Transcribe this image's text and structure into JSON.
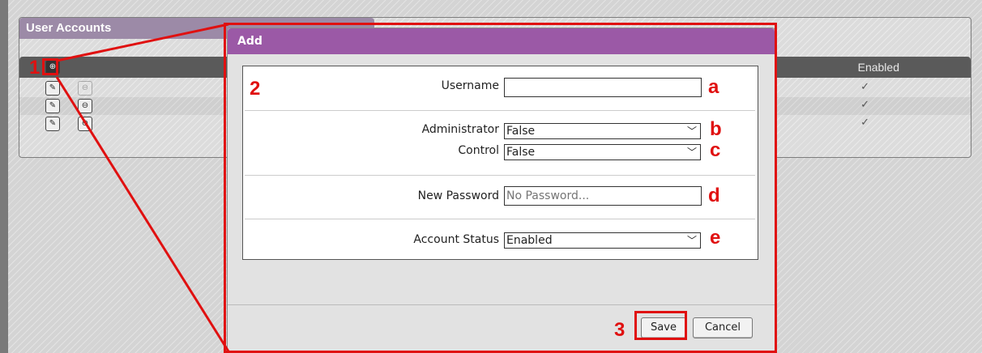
{
  "background_panel": {
    "title": "User Accounts",
    "enabled_column": "Enabled",
    "rows": [
      {
        "enabled": "✓"
      },
      {
        "enabled": "✓"
      },
      {
        "enabled": "✓"
      }
    ]
  },
  "dialog": {
    "title": "Add",
    "fields": {
      "username_label": "Username",
      "username_value": "",
      "administrator_label": "Administrator",
      "administrator_value": "False",
      "control_label": "Control",
      "control_value": "False",
      "new_password_label": "New Password",
      "new_password_placeholder": "No Password...",
      "account_status_label": "Account Status",
      "account_status_value": "Enabled"
    },
    "buttons": {
      "save": "Save",
      "cancel": "Cancel"
    }
  },
  "annotations": {
    "step1": "1",
    "step2": "2",
    "step3": "3",
    "a": "a",
    "b": "b",
    "c": "c",
    "d": "d",
    "e": "e"
  },
  "colors": {
    "dialog_header": "#9b59a6",
    "annotation_red": "#e01010",
    "panel_header": "#9c8aa7"
  },
  "icons": {
    "add": "plus-circle-icon",
    "edit": "wrench-icon",
    "delete": "minus-circle-icon",
    "dropdown": "chevron-down-icon",
    "enabled": "checkmark-icon"
  }
}
